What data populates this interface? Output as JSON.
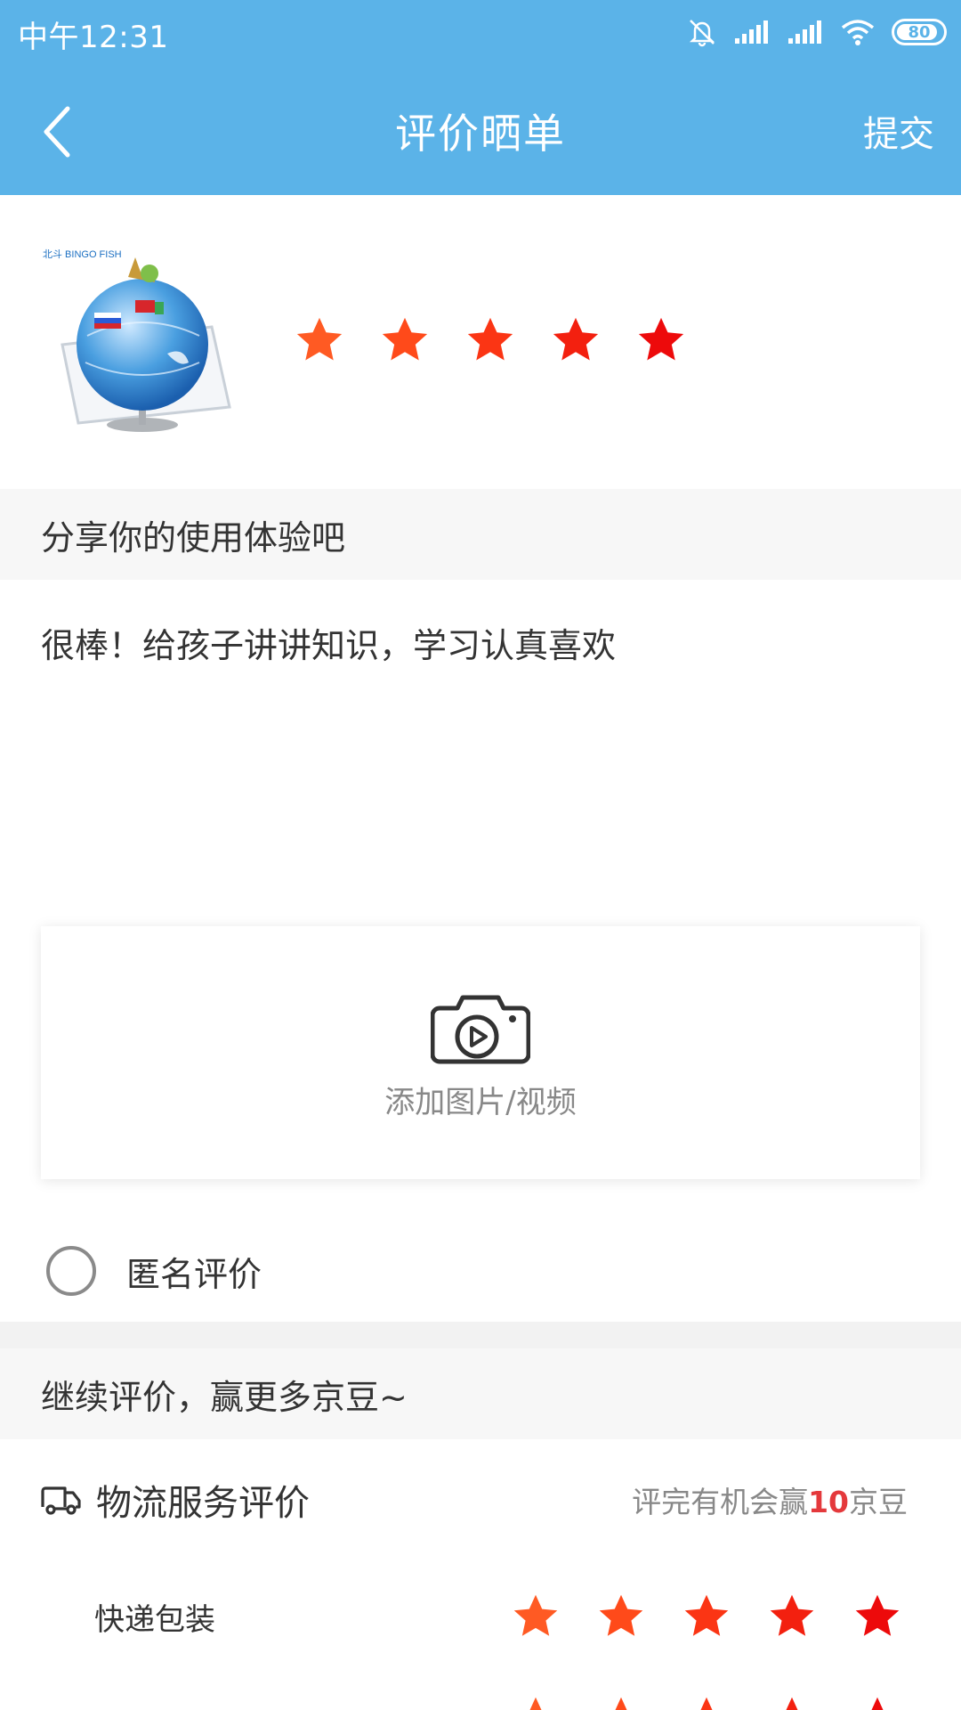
{
  "status_bar": {
    "time": "中午12:31",
    "battery": "80",
    "icons": [
      "bell-muted-icon",
      "signal-icon",
      "signal-icon",
      "wifi-icon",
      "battery-icon"
    ]
  },
  "header": {
    "title": "评价晒单",
    "submit_label": "提交",
    "back_icon": "chevron-left-icon"
  },
  "product": {
    "image_alt": "globe-product-image",
    "logo_text": "北斗 BINGO FISH",
    "rating": 5,
    "max_rating": 5
  },
  "review": {
    "section_title": "分享你的使用体验吧",
    "text": "很棒！给孩子讲讲知识，学习认真喜欢"
  },
  "upload": {
    "label": "添加图片/视频",
    "icon": "camera-video-icon"
  },
  "anonymous": {
    "label": "匿名评价",
    "checked": false
  },
  "more": {
    "section_title": "继续评价，赢更多京豆~"
  },
  "logistics": {
    "title": "物流服务评价",
    "hint_prefix": "评完有机会赢",
    "hint_number": "10",
    "hint_suffix": "京豆",
    "icon": "truck-icon",
    "items": [
      {
        "label": "快递包装",
        "rating": 5
      },
      {
        "label": "",
        "rating": 5
      }
    ]
  },
  "colors": {
    "header_bg": "#5bb3e8",
    "star_gradient": [
      "#ff5a23",
      "#ff4a1a",
      "#fb3514",
      "#f3200f",
      "#ed0a0b"
    ],
    "highlight": "#e4393c"
  }
}
